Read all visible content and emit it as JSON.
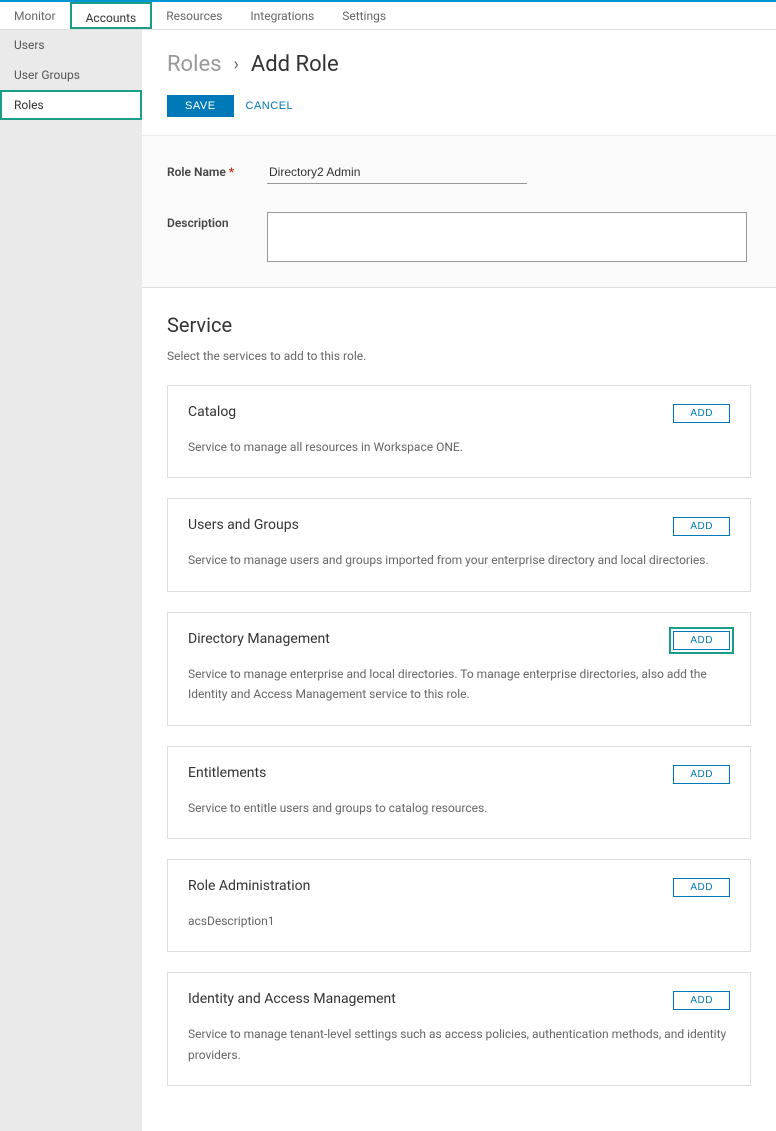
{
  "topTabs": [
    {
      "label": "Monitor",
      "active": false,
      "highlighted": false
    },
    {
      "label": "Accounts",
      "active": true,
      "highlighted": true
    },
    {
      "label": "Resources",
      "active": false,
      "highlighted": false
    },
    {
      "label": "Integrations",
      "active": false,
      "highlighted": false
    },
    {
      "label": "Settings",
      "active": false,
      "highlighted": false
    }
  ],
  "sidebar": [
    {
      "label": "Users",
      "active": false,
      "highlighted": false
    },
    {
      "label": "User Groups",
      "active": false,
      "highlighted": false
    },
    {
      "label": "Roles",
      "active": true,
      "highlighted": true
    }
  ],
  "breadcrumb": {
    "parent": "Roles",
    "sep": "›",
    "current": "Add Role"
  },
  "actions": {
    "save": "SAVE",
    "cancel": "CANCEL"
  },
  "form": {
    "roleNameLabel": "Role Name",
    "roleNameValue": "Directory2 Admin",
    "descriptionLabel": "Description",
    "descriptionValue": ""
  },
  "serviceSection": {
    "title": "Service",
    "subtitle": "Select the services to add to this role."
  },
  "services": [
    {
      "title": "Catalog",
      "desc": "Service to manage all resources in Workspace ONE.",
      "addLabel": "ADD",
      "highlighted": false
    },
    {
      "title": "Users and Groups",
      "desc": "Service to manage users and groups imported from your enterprise directory and local directories.",
      "addLabel": "ADD",
      "highlighted": false
    },
    {
      "title": "Directory Management",
      "desc": "Service to manage enterprise and local directories. To manage enterprise directories, also add the Identity and Access Management service to this role.",
      "addLabel": "ADD",
      "highlighted": true
    },
    {
      "title": "Entitlements",
      "desc": "Service to entitle users and groups to catalog resources.",
      "addLabel": "ADD",
      "highlighted": false
    },
    {
      "title": "Role Administration",
      "desc": "acsDescription1",
      "addLabel": "ADD",
      "highlighted": false
    },
    {
      "title": "Identity and Access Management",
      "desc": "Service to manage tenant-level settings such as access policies, authentication methods, and identity providers.",
      "addLabel": "ADD",
      "highlighted": false
    }
  ]
}
